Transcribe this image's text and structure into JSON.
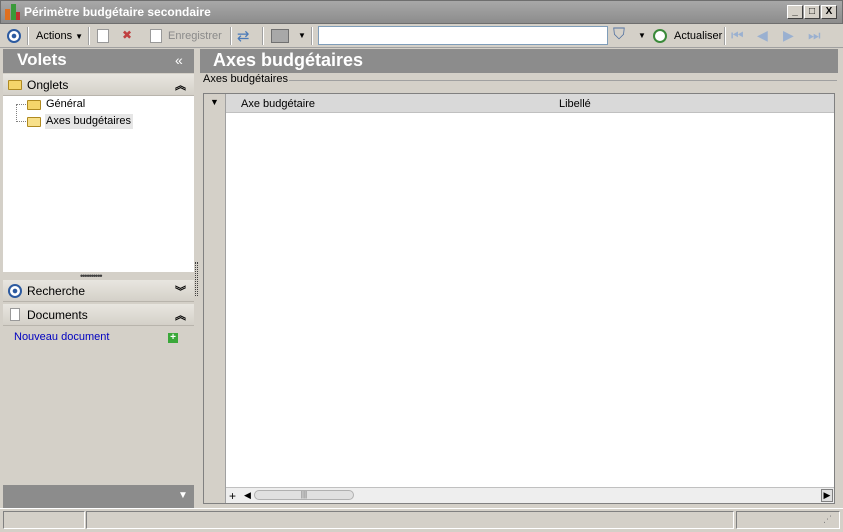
{
  "window": {
    "title": "Périmètre budgétaire secondaire",
    "controls": [
      "_",
      "□",
      "X"
    ]
  },
  "toolbar": {
    "actions_label": "Actions",
    "save_label": "Enregistrer",
    "search_value": "",
    "refresh_label": "Actualiser"
  },
  "left_pane": {
    "title": "Volets",
    "collapse_glyph": "«",
    "tabs_section": {
      "label": "Onglets",
      "items": [
        {
          "label": "Général"
        },
        {
          "label": "Axes budgétaires",
          "selected": true
        }
      ]
    },
    "search_section": {
      "label": "Recherche"
    },
    "documents_section": {
      "label": "Documents",
      "new_document": "Nouveau document"
    }
  },
  "right_pane": {
    "title": "Axes budgétaires",
    "group_label": "Axes budgétaires",
    "grid": {
      "columns": [
        "Axe budgétaire",
        "Libellé"
      ],
      "rows": []
    }
  },
  "colors": {
    "header_bg": "#8c8c8c",
    "accent_blue": "#2c5aa0",
    "link": "#0000c0"
  }
}
